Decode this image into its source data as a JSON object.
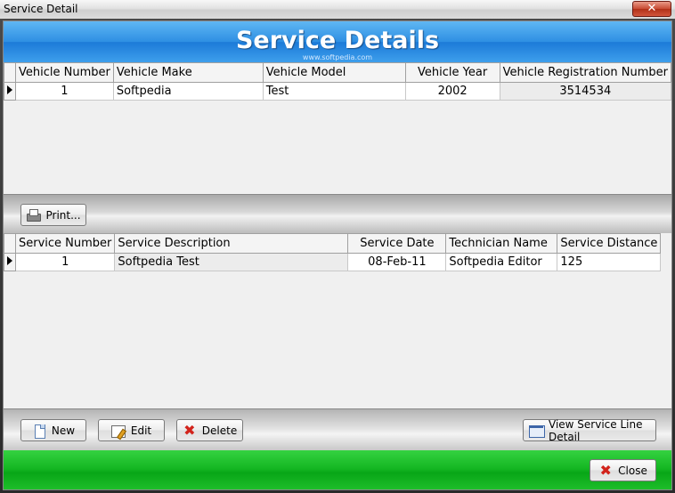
{
  "window": {
    "title": "Service Detail",
    "close_glyph": "✕"
  },
  "header": {
    "title": "Service Details",
    "watermark": "www.softpedia.com"
  },
  "vehicle_grid": {
    "columns": [
      "Vehicle Number",
      "Vehicle Make",
      "Vehicle Model",
      "Vehicle Year",
      "Vehicle Registration Number"
    ],
    "rows": [
      [
        "1",
        "Softpedia",
        "Test",
        "2002",
        "3514534"
      ]
    ]
  },
  "print_toolbar": {
    "print_label": "Print...",
    "print_icon": "printer-icon"
  },
  "service_grid": {
    "columns": [
      "Service Number",
      "Service Description",
      "Service Date",
      "Technician Name",
      "Service Distance"
    ],
    "rows": [
      [
        "1",
        "Softpedia Test",
        "08-Feb-11",
        "Softpedia Editor",
        "125"
      ]
    ]
  },
  "actions": {
    "new_label": "New",
    "edit_label": "Edit",
    "delete_label": "Delete",
    "view_line_label": "View Service Line Detail",
    "close_label": "Close"
  },
  "colors": {
    "header_blue": "#2e8fe3",
    "footer_green": "#14b622",
    "delete_red": "#d2231b"
  }
}
